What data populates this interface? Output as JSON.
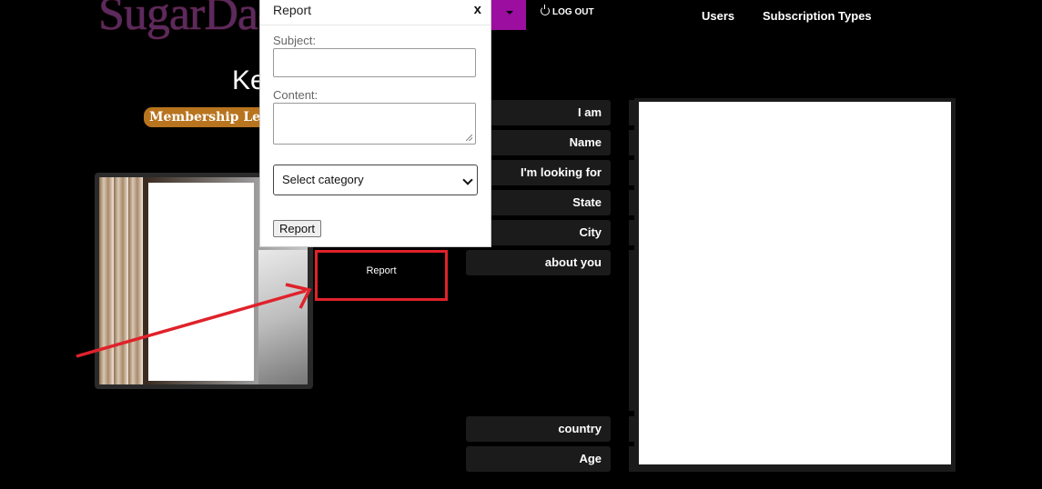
{
  "header": {
    "logo_text": "SugarDaddy",
    "logout_label": "LOG OUT",
    "nav": {
      "users": "Users",
      "subscription_types": "Subscription Types"
    }
  },
  "profile": {
    "name_partial": "Ke",
    "membership_badge": "Membership Level"
  },
  "report_link": {
    "label": "Report"
  },
  "modal": {
    "title": "Report",
    "close_label": "x",
    "subject_label": "Subject:",
    "subject_value": "",
    "content_label": "Content:",
    "content_value": "",
    "category_selected": "Select category",
    "submit_label": "Report"
  },
  "fields": {
    "i_am": "I am",
    "name": "Name",
    "looking_for": "I'm looking for",
    "state": "State",
    "city": "City",
    "about": "about you",
    "country": "country",
    "age": "Age"
  },
  "colors": {
    "accent_purple": "#9b0ea0",
    "badge_orange": "#b8741e",
    "highlight_red": "#e0222b"
  }
}
